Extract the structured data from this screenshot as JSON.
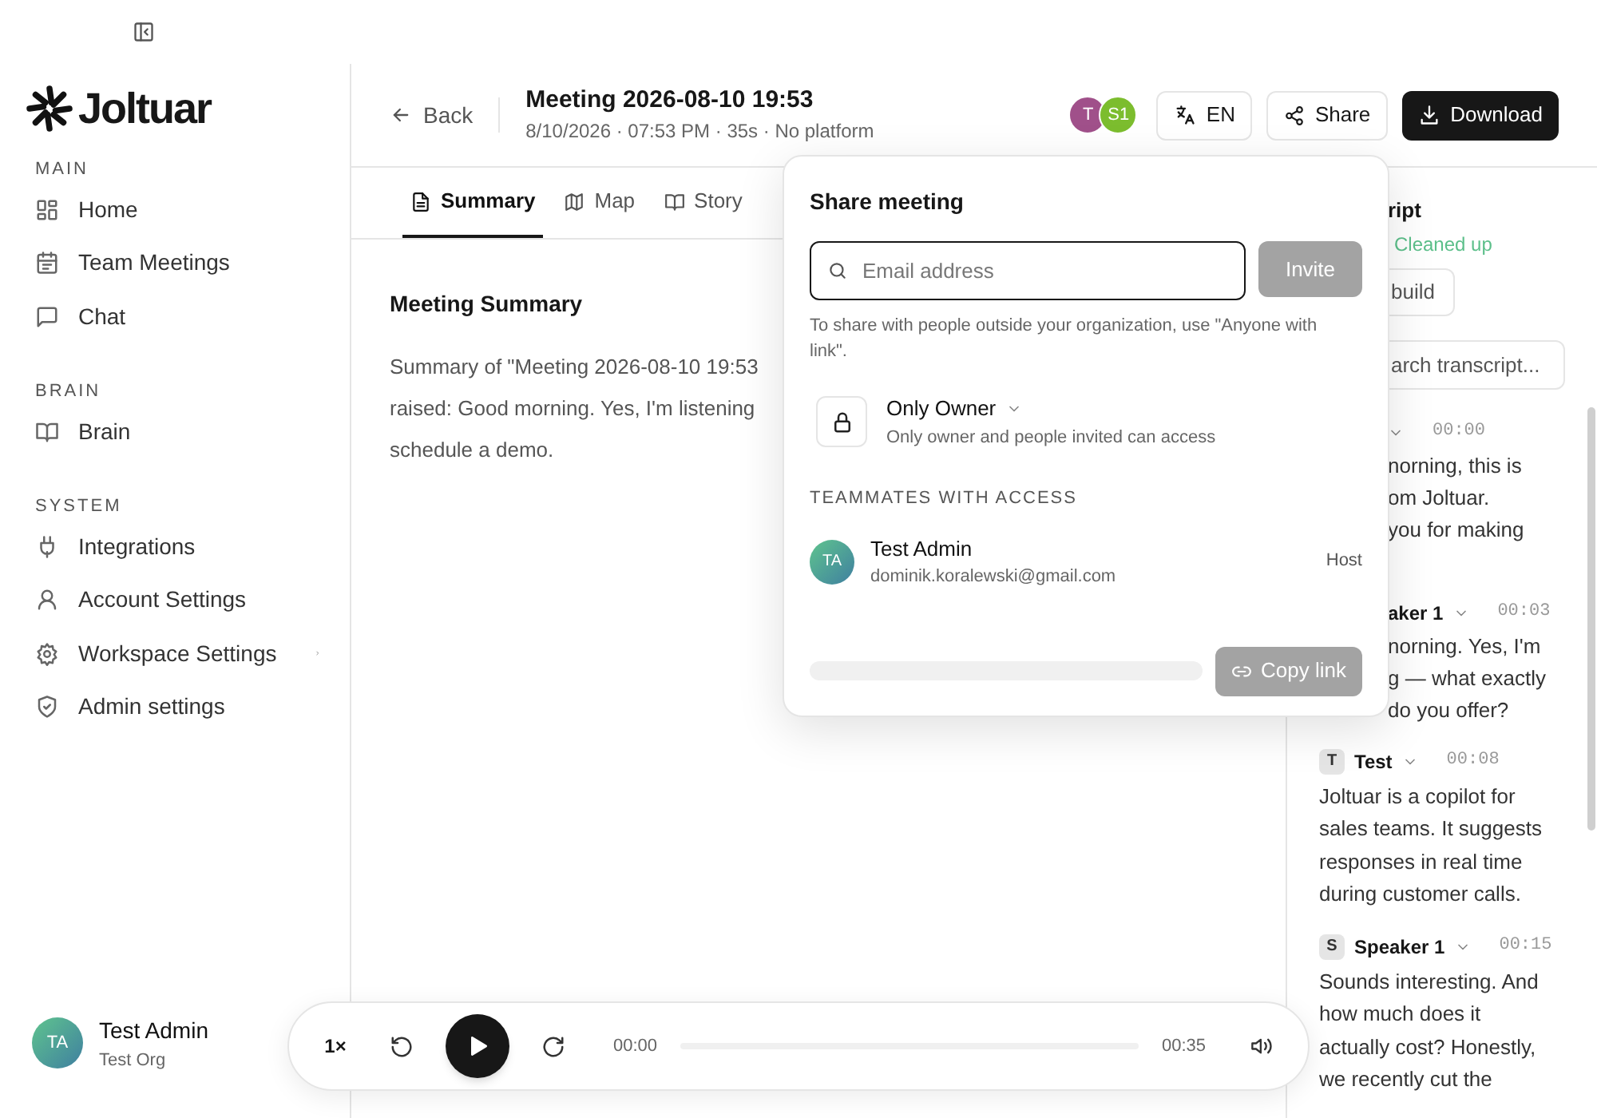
{
  "sidebar": {
    "logo": "Joltuar",
    "sections": [
      {
        "heading": "MAIN",
        "items": [
          {
            "label": "Home",
            "has_submenu": false
          },
          {
            "label": "Team Meetings",
            "has_submenu": false
          },
          {
            "label": "Chat",
            "has_submenu": false
          }
        ]
      },
      {
        "heading": "BRAIN",
        "items": [
          {
            "label": "Brain",
            "has_submenu": false
          }
        ]
      },
      {
        "heading": "SYSTEM",
        "items": [
          {
            "label": "Integrations",
            "has_submenu": false
          },
          {
            "label": "Account Settings",
            "has_submenu": false
          },
          {
            "label": "Workspace Settings",
            "has_submenu": true
          },
          {
            "label": "Admin settings",
            "has_submenu": false
          }
        ]
      }
    ],
    "user": {
      "initials": "TA",
      "name": "Test Admin",
      "org": "Test Org"
    }
  },
  "header": {
    "back": "Back",
    "title": "Meeting 2026-08-10 19:53",
    "meta": "8/10/2026 · 07:53 PM · 35s · No platform",
    "participants": [
      {
        "initials": "T",
        "color": "#a0508a"
      },
      {
        "initials": "S1",
        "color": "#7cbd2e"
      }
    ],
    "language": "EN",
    "share": "Share",
    "download": "Download"
  },
  "tabs": [
    {
      "label": "Summary",
      "selected": true
    },
    {
      "label": "Map",
      "selected": false
    },
    {
      "label": "Story",
      "selected": false
    }
  ],
  "summary": {
    "heading": "Meeting Summary",
    "text": "Summary of \"Meeting 2026-08-10 19:53\nraised: Good morning. Yes, I'm listening\nschedule a demo."
  },
  "share_popover": {
    "title": "Share meeting",
    "email_placeholder": "Email address",
    "invite": "Invite",
    "invite_disabled": true,
    "hint": "To share with people outside your organization, use \"Anyone with link\".",
    "access": {
      "label": "Only Owner",
      "description": "Only owner and people invited can access"
    },
    "section": "TEAMMATES WITH ACCESS",
    "members": [
      {
        "initials": "TA",
        "name": "Test Admin",
        "email": "dominik.koralewski@gmail.com",
        "role": "Host"
      }
    ],
    "copy_link": "Copy link",
    "copy_disabled": true
  },
  "transcript": {
    "title": "ript",
    "status": "Cleaned up",
    "rebuild": "build",
    "search_placeholder": "arch transcript...",
    "messages": [
      {
        "kind": "covered",
        "time": "00:00",
        "lines": [
          "norning, this is",
          "om Joltuar.",
          "you for making"
        ]
      },
      {
        "kind": "covered",
        "speaker": "aker 1",
        "time": "00:03",
        "lines": [
          "norning. Yes, I'm",
          "g — what exactly",
          "do you offer?"
        ]
      },
      {
        "kind": "full",
        "badge": "T",
        "speaker": "Test",
        "time": "00:08",
        "text": "Joltuar is a copilot for sales teams. It suggests responses in real time during customer calls."
      },
      {
        "kind": "full",
        "badge": "S",
        "speaker": "Speaker 1",
        "time": "00:15",
        "text": "Sounds interesting. And how much does it actually cost? Honestly, we recently cut the"
      }
    ]
  },
  "player": {
    "speed": "1×",
    "current": "00:00",
    "duration": "00:35",
    "level": 0
  }
}
